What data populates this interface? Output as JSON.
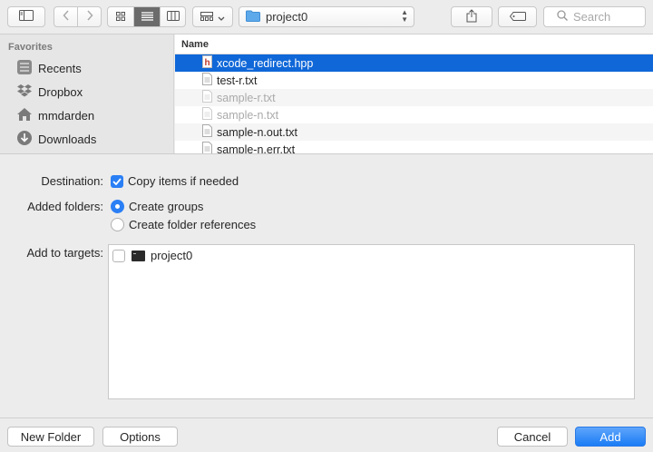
{
  "toolbar": {
    "path_label": "project0",
    "search_placeholder": "Search"
  },
  "sidebar": {
    "heading": "Favorites",
    "items": [
      {
        "label": "Recents",
        "icon": "clock-icon"
      },
      {
        "label": "Dropbox",
        "icon": "dropbox-icon"
      },
      {
        "label": "mmdarden",
        "icon": "home-icon"
      },
      {
        "label": "Downloads",
        "icon": "download-icon"
      }
    ]
  },
  "files": {
    "column": "Name",
    "rows": [
      {
        "name": "xcode_redirect.hpp",
        "icon": "header-file-icon"
      },
      {
        "name": "test-r.txt",
        "icon": "text-file-icon"
      },
      {
        "name": "sample-r.txt",
        "icon": "text-file-icon"
      },
      {
        "name": "sample-n.txt",
        "icon": "text-file-icon"
      },
      {
        "name": "sample-n.out.txt",
        "icon": "text-file-icon"
      },
      {
        "name": "sample-n.err.txt",
        "icon": "text-file-icon"
      }
    ]
  },
  "options": {
    "destination_label": "Destination:",
    "copy_label": "Copy items if needed",
    "folders_label": "Added folders:",
    "groups_label": "Create groups",
    "refs_label": "Create folder references",
    "targets_label": "Add to targets:",
    "target_name": "project0"
  },
  "footer": {
    "new_folder": "New Folder",
    "options": "Options",
    "cancel": "Cancel",
    "add": "Add"
  },
  "colors": {
    "accent": "#0f67d8",
    "primary_button": "#1a7cf5"
  }
}
